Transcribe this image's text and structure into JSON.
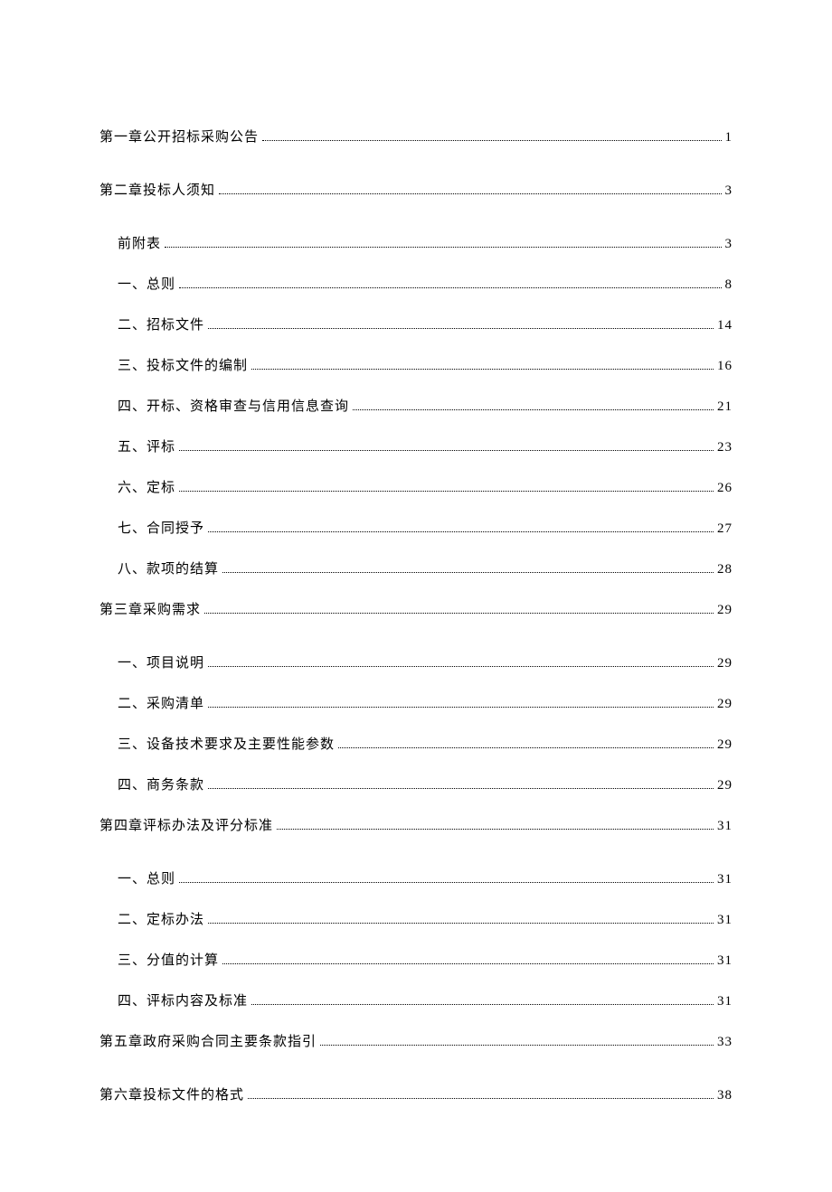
{
  "toc": [
    {
      "level": 1,
      "label": "第一章公开招标采购公告",
      "page": "1"
    },
    {
      "level": 1,
      "label": "第二章投标人须知",
      "page": "3"
    },
    {
      "level": 2,
      "label": "前附表",
      "page": "3"
    },
    {
      "level": 2,
      "label": "一、总则",
      "page": "8"
    },
    {
      "level": 2,
      "label": "二、招标文件",
      "page": "14"
    },
    {
      "level": 2,
      "label": "三、投标文件的编制",
      "page": "16"
    },
    {
      "level": 2,
      "label": "四、开标、资格审查与信用信息查询",
      "page": "21"
    },
    {
      "level": 2,
      "label": "五、评标",
      "page": "23"
    },
    {
      "level": 2,
      "label": "六、定标",
      "page": "26"
    },
    {
      "level": 2,
      "label": "七、合同授予",
      "page": "27"
    },
    {
      "level": 2,
      "label": "八、款项的结算",
      "page": "28"
    },
    {
      "level": 1,
      "label": "第三章采购需求",
      "page": "29"
    },
    {
      "level": 2,
      "label": "一、项目说明",
      "page": "29"
    },
    {
      "level": 2,
      "label": "二、采购清单",
      "page": "29"
    },
    {
      "level": 2,
      "label": "三、设备技术要求及主要性能参数",
      "page": "29"
    },
    {
      "level": 2,
      "label": "四、商务条款",
      "page": "29"
    },
    {
      "level": 1,
      "label": "第四章评标办法及评分标准",
      "page": "31"
    },
    {
      "level": 2,
      "label": "一、总则",
      "page": "31"
    },
    {
      "level": 2,
      "label": "二、定标办法",
      "page": "31"
    },
    {
      "level": 2,
      "label": "三、分值的计算",
      "page": "31"
    },
    {
      "level": 2,
      "label": "四、评标内容及标准",
      "page": "31"
    },
    {
      "level": 1,
      "label": "第五章政府采购合同主要条款指引",
      "page": "33"
    },
    {
      "level": 1,
      "label": "第六章投标文件的格式",
      "page": "38"
    }
  ]
}
